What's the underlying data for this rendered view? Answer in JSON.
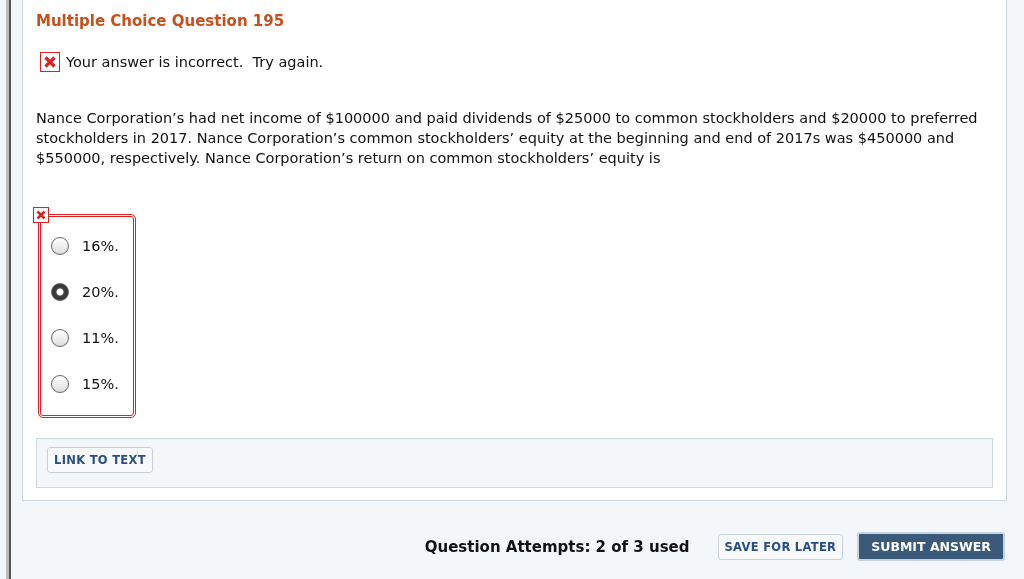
{
  "question": {
    "title": "Multiple Choice Question 195",
    "feedback": "Your answer is incorrect.  Try again.",
    "text": "Nance Corporation’s had net income of $100000 and paid dividends of $25000 to common stockholders and $20000 to preferred stockholders in 2017. Nance Corporation’s common stockholders’ equity at the beginning and end of 2017s was $450000 and $550000, respectively. Nance Corporation’s return on common stockholders’ equity is"
  },
  "options": [
    {
      "label": "16%.",
      "selected": false
    },
    {
      "label": "20%.",
      "selected": true
    },
    {
      "label": "11%.",
      "selected": false
    },
    {
      "label": "15%.",
      "selected": false
    }
  ],
  "link_button": "LINK TO TEXT",
  "footer": {
    "attempts": "Question Attempts: 2 of 3 used",
    "save": "SAVE FOR LATER",
    "submit": "SUBMIT ANSWER"
  }
}
